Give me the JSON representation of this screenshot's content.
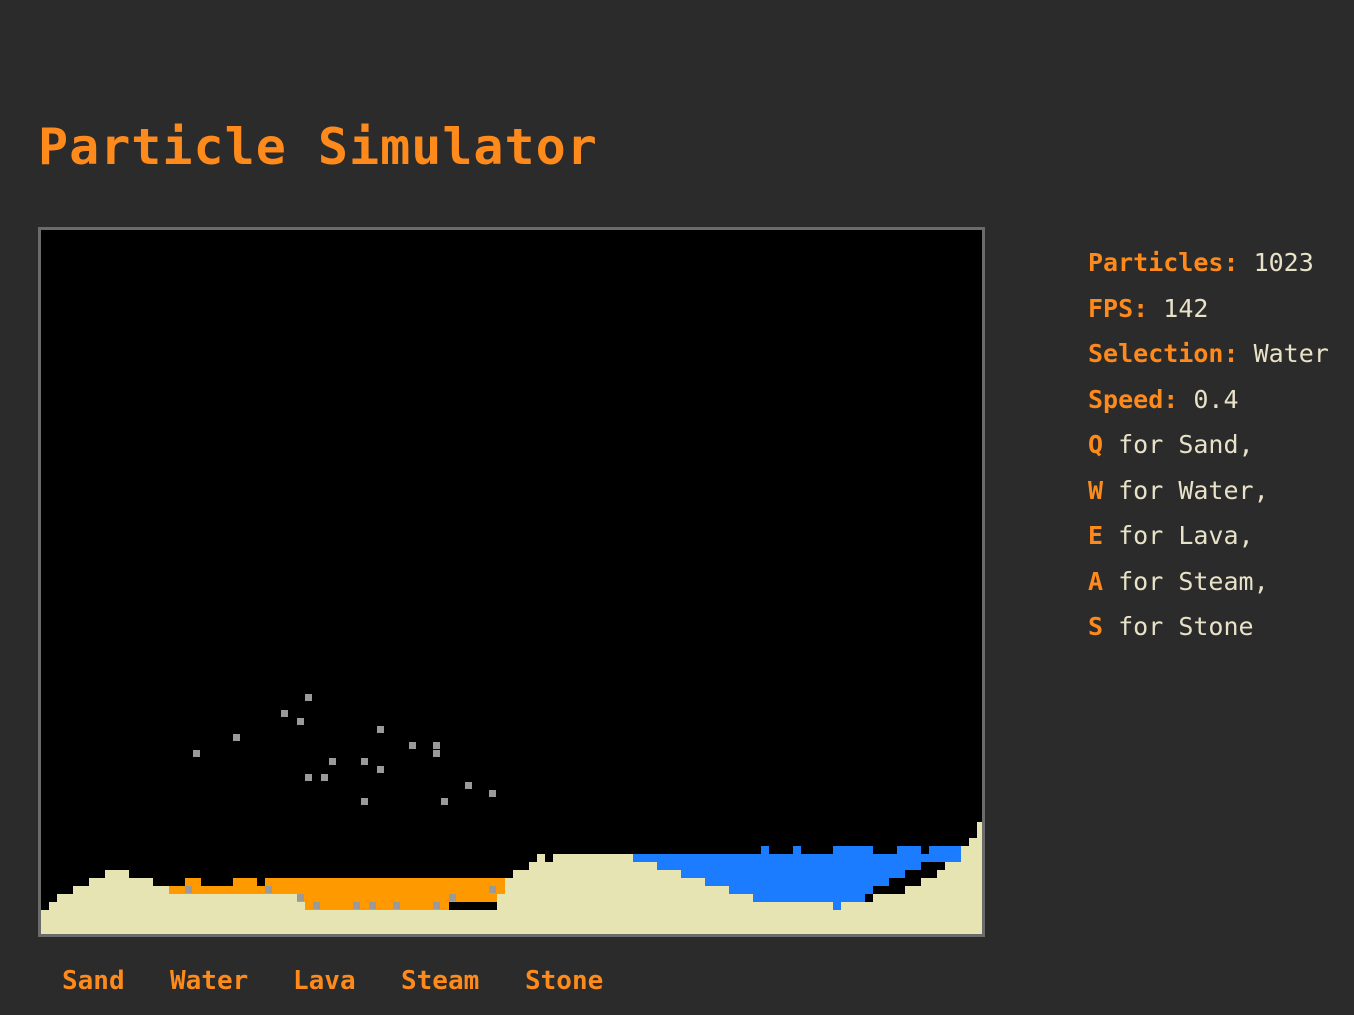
{
  "title": "Particle Simulator",
  "stats": {
    "particles_label": "Particles:",
    "particles_value": "1023",
    "fps_label": "FPS:",
    "fps_value": "142",
    "selection_label": "Selection:",
    "selection_value": "Water",
    "speed_label": "Speed:",
    "speed_value": "0.4"
  },
  "keys": [
    {
      "key": "Q",
      "text": " for Sand,"
    },
    {
      "key": "W",
      "text": " for Water,"
    },
    {
      "key": "E",
      "text": " for Lava,"
    },
    {
      "key": "A",
      "text": " for Steam,"
    },
    {
      "key": "S",
      "text": " for Stone"
    }
  ],
  "buttons": [
    "Sand",
    "Water",
    "Lava",
    "Steam",
    "Stone"
  ],
  "colors": {
    "background": "#2b2b2b",
    "accent": "#ff8a1c",
    "text": "#e8e2c8",
    "canvas": "#000000",
    "sand": "#e5e4b2",
    "water": "#1c7cff",
    "lava": "#ff9900",
    "steam": "#9a9a9a"
  }
}
